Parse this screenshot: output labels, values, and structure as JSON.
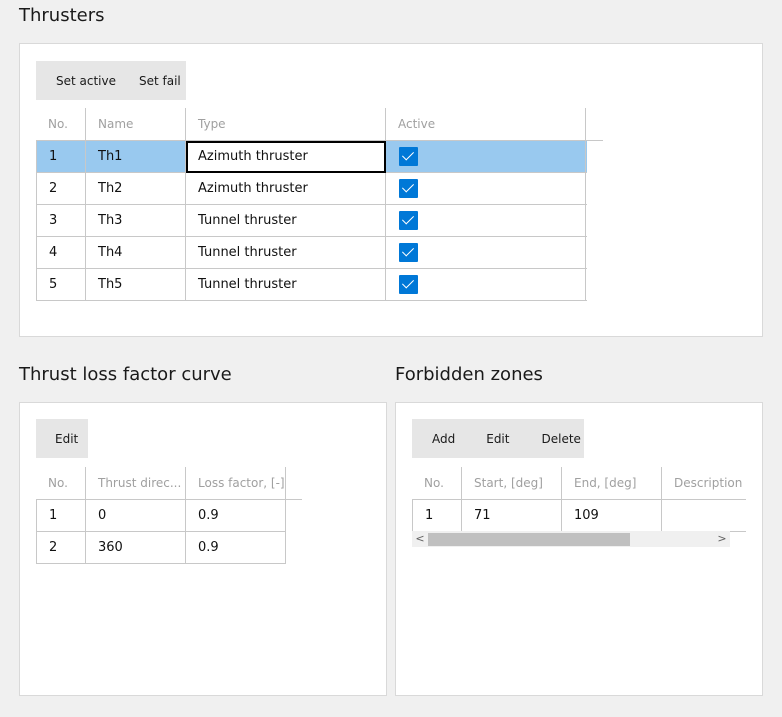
{
  "thrusters": {
    "title": "Thrusters",
    "toolbar": {
      "set_active": "Set active",
      "set_fail": "Set fail"
    },
    "columns": [
      "No.",
      "Name",
      "Type",
      "Active"
    ],
    "rows": [
      {
        "no": "1",
        "name": "Th1",
        "type": "Azimuth thruster",
        "active": true
      },
      {
        "no": "2",
        "name": "Th2",
        "type": "Azimuth thruster",
        "active": true
      },
      {
        "no": "3",
        "name": "Th3",
        "type": "Tunnel thruster",
        "active": true
      },
      {
        "no": "4",
        "name": "Th4",
        "type": "Tunnel thruster",
        "active": true
      },
      {
        "no": "5",
        "name": "Th5",
        "type": "Tunnel thruster",
        "active": true
      }
    ]
  },
  "thrust_loss": {
    "title": "Thrust loss factor curve",
    "toolbar": {
      "edit": "Edit"
    },
    "columns": [
      "No.",
      "Thrust direc...",
      "Loss factor, [-]"
    ],
    "rows": [
      {
        "no": "1",
        "direction": "0",
        "factor": "0.9"
      },
      {
        "no": "2",
        "direction": "360",
        "factor": "0.9"
      }
    ]
  },
  "forbidden_zones": {
    "title": "Forbidden zones",
    "toolbar": {
      "add": "Add",
      "edit": "Edit",
      "delete": "Delete"
    },
    "columns": [
      "No.",
      "Start, [deg]",
      "End, [deg]",
      "Description"
    ],
    "rows": [
      {
        "no": "1",
        "start": "71",
        "end": "109",
        "description": ""
      }
    ],
    "scroll_left_icon": "chevron-left-icon",
    "scroll_right_icon": "chevron-right-icon",
    "scroll_left_glyph": "<",
    "scroll_right_glyph": ">"
  },
  "colors": {
    "selected_row": "#99c9ef",
    "checkbox": "#0078d7",
    "toolbar": "#e6e6e6",
    "background": "#f0f0f0"
  }
}
